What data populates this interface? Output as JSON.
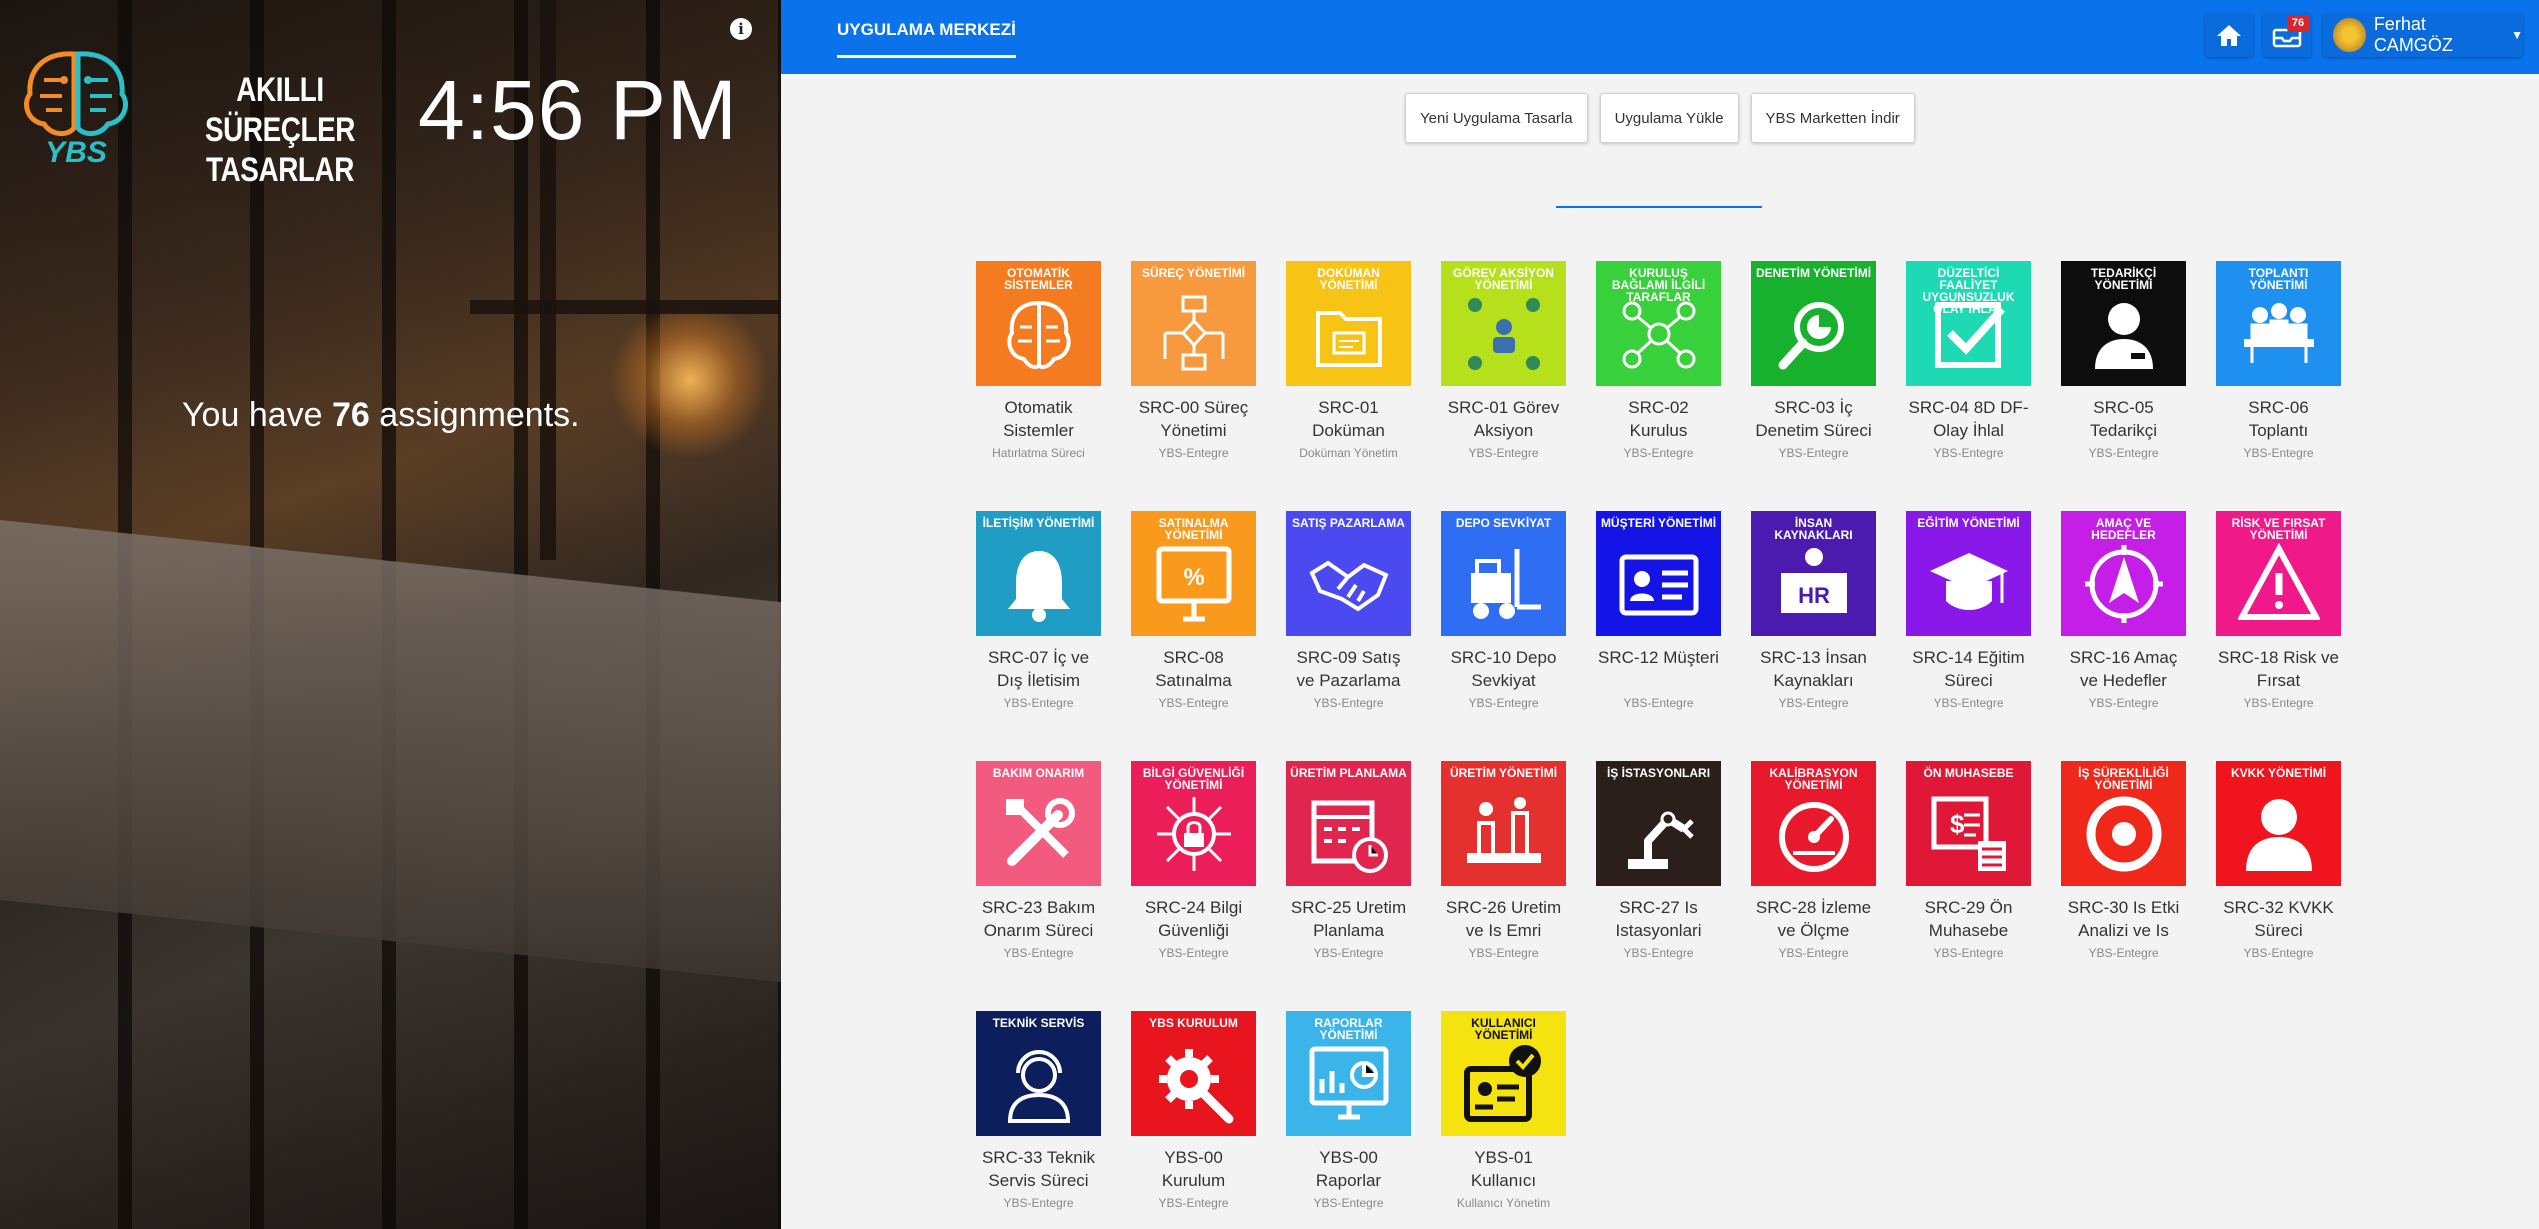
{
  "left_panel": {
    "brand_line1": "AKILLI SÜREÇLER",
    "brand_line2": "TASARLAR",
    "logo_text": "YBS",
    "clock": "4:56 PM",
    "info_icon": "info-icon",
    "assign_prefix": "You have",
    "assign_count": "76",
    "assign_suffix": "assignments."
  },
  "topbar": {
    "tab": "UYGULAMA MERKEZİ",
    "badge_count": "76",
    "user_name": "Ferhat CAMGÖZ",
    "color": "#0a73eb"
  },
  "actions": [
    "Yeni Uygulama Tasarla",
    "Uygulama Yükle",
    "YBS Marketten İndir"
  ],
  "search": {
    "placeholder": ""
  },
  "apps": [
    {
      "tile": "OTOMATİK SİSTEMLER",
      "name": "Otomatik Sistemler",
      "sub": "Hatırlatma Süreci",
      "color": "#f47b20",
      "icon": "brain-icon"
    },
    {
      "tile": "SÜREÇ YÖNETİMİ",
      "name": "SRC-00 Süreç Yönetimi",
      "sub": "YBS-Entegre",
      "color": "#f79a3e",
      "icon": "flowchart-icon"
    },
    {
      "tile": "DOKÜMAN YÖNETİMİ",
      "name": "SRC-01 Doküman",
      "sub": "Doküman Yönetim",
      "color": "#f7c415",
      "icon": "folder-icon"
    },
    {
      "tile": "GÖREV AKSİYON YÖNETİMİ",
      "name": "SRC-01 Görev Aksiyon",
      "sub": "YBS-Entegre",
      "color": "#b6e01b",
      "icon": "task-icon"
    },
    {
      "tile": "KURULUŞ BAĞLAMI İLGİLİ TARAFLAR",
      "name": "SRC-02 Kurulus",
      "sub": "YBS-Entegre",
      "color": "#38d13b",
      "icon": "network-icon"
    },
    {
      "tile": "DENETİM YÖNETİMİ",
      "name": "SRC-03 İç Denetim Süreci",
      "sub": "YBS-Entegre",
      "color": "#17b12d",
      "icon": "magnifier-icon"
    },
    {
      "tile": "DÜZELTİCİ FAALİYET UYGUNSUZLUK OLAY İHLAL",
      "name": "SRC-04 8D DF-Olay İhlal",
      "sub": "YBS-Entegre",
      "color": "#1dd9b4",
      "icon": "checkbox-icon"
    },
    {
      "tile": "TEDARİKÇİ YÖNETİMİ",
      "name": "SRC-05 Tedarikçi",
      "sub": "YBS-Entegre",
      "color": "#0d0d0d",
      "icon": "person-icon"
    },
    {
      "tile": "TOPLANTI YÖNETİMİ",
      "name": "SRC-06 Toplantı",
      "sub": "YBS-Entegre",
      "color": "#1e90f0",
      "icon": "meeting-icon"
    },
    {
      "tile": "İLETİŞİM YÖNETİMİ",
      "name": "SRC-07 İç ve Dış İletisim",
      "sub": "YBS-Entegre",
      "color": "#1f9dc4",
      "icon": "bell-icon"
    },
    {
      "tile": "SATINALMA YÖNETİMİ",
      "name": "SRC-08 Satınalma",
      "sub": "YBS-Entegre",
      "color": "#f99a1d",
      "icon": "monitor-percent-icon"
    },
    {
      "tile": "SATIŞ PAZARLAMA",
      "name": "SRC-09 Satış ve Pazarlama",
      "sub": "YBS-Entegre",
      "color": "#4a4af0",
      "icon": "handshake-icon"
    },
    {
      "tile": "DEPO SEVKİYAT",
      "name": "SRC-10 Depo Sevkiyat",
      "sub": "YBS-Entegre",
      "color": "#2f6ef2",
      "icon": "forklift-icon"
    },
    {
      "tile": "MÜŞTERİ YÖNETİMİ",
      "name": "SRC-12 Müşteri",
      "sub": "YBS-Entegre",
      "color": "#1414e6",
      "icon": "id-card-icon"
    },
    {
      "tile": "İNSAN KAYNAKLARI",
      "name": "SRC-13 İnsan Kaynakları",
      "sub": "YBS-Entegre",
      "color": "#4b1bb0",
      "icon": "hr-desk-icon"
    },
    {
      "tile": "EĞİTİM YÖNETİMİ",
      "name": "SRC-14 Eğitim Süreci",
      "sub": "YBS-Entegre",
      "color": "#8a18e8",
      "icon": "graduation-cap-icon"
    },
    {
      "tile": "AMAÇ VE HEDEFLER",
      "name": "SRC-16 Amaç ve Hedefler",
      "sub": "YBS-Entegre",
      "color": "#c51ee6",
      "icon": "target-icon"
    },
    {
      "tile": "RİSK VE FIRSAT YÖNETİMİ",
      "name": "SRC-18 Risk ve Fırsat",
      "sub": "YBS-Entegre",
      "color": "#f0198a",
      "icon": "warning-icon"
    },
    {
      "tile": "BAKIM ONARIM",
      "name": "SRC-23 Bakım Onarım Süreci",
      "sub": "YBS-Entegre",
      "color": "#f25a7f",
      "icon": "tools-icon"
    },
    {
      "tile": "BİLGİ GÜVENLİĞİ YÖNETİMİ",
      "name": "SRC-24 Bilgi Güvenliği",
      "sub": "YBS-Entegre",
      "color": "#eb1e5a",
      "icon": "lock-network-icon"
    },
    {
      "tile": "ÜRETİM PLANLAMA",
      "name": "SRC-25 Uretim Planlama",
      "sub": "YBS-Entegre",
      "color": "#e0264f",
      "icon": "calendar-clock-icon"
    },
    {
      "tile": "ÜRETİM YÖNETİMİ",
      "name": "SRC-26 Uretim ve Is Emri",
      "sub": "YBS-Entegre",
      "color": "#e53030",
      "icon": "production-line-icon"
    },
    {
      "tile": "İŞ İSTASYONLARI",
      "name": "SRC-27 Is Istasyonlari",
      "sub": "YBS-Entegre",
      "color": "#2b1f1b",
      "icon": "robot-arm-icon"
    },
    {
      "tile": "KALİBRASYON YÖNETİMİ",
      "name": "SRC-28 İzleme ve Ölçme",
      "sub": "YBS-Entegre",
      "color": "#e8192c",
      "icon": "gauge-icon"
    },
    {
      "tile": "ÖN MUHASEBE",
      "name": "SRC-29 Ön Muhasebe",
      "sub": "YBS-Entegre",
      "color": "#e01838",
      "icon": "invoice-icon"
    },
    {
      "tile": "İŞ SÜREKLİLİĞİ YÖNETİMİ",
      "name": "SRC-30 Is Etki Analizi ve Is",
      "sub": "YBS-Entegre",
      "color": "#f0281c",
      "icon": "cycle-icon"
    },
    {
      "tile": "KVKK YÖNETİMİ",
      "name": "SRC-32 KVKK Süreci",
      "sub": "YBS-Entegre",
      "color": "#f0141e",
      "icon": "user-icon"
    },
    {
      "tile": "TEKNİK SERVİS",
      "name": "SRC-33 Teknik Servis Süreci",
      "sub": "YBS-Entegre",
      "color": "#0c1f5c",
      "icon": "headset-icon"
    },
    {
      "tile": "YBS KURULUM",
      "name": "YBS-00 Kurulum",
      "sub": "YBS-Entegre",
      "color": "#e8141e",
      "icon": "gear-wrench-icon"
    },
    {
      "tile": "RAPORLAR YÖNETİMİ",
      "name": "YBS-00 Raporlar",
      "sub": "YBS-Entegre",
      "color": "#3bb4ea",
      "icon": "report-icon"
    },
    {
      "tile": "KULLANICI YÖNETİMİ",
      "name": "YBS-01 Kullanıcı",
      "sub": "Kullanıcı Yönetim",
      "color": "#f5e30f",
      "icon": "user-check-icon"
    }
  ]
}
